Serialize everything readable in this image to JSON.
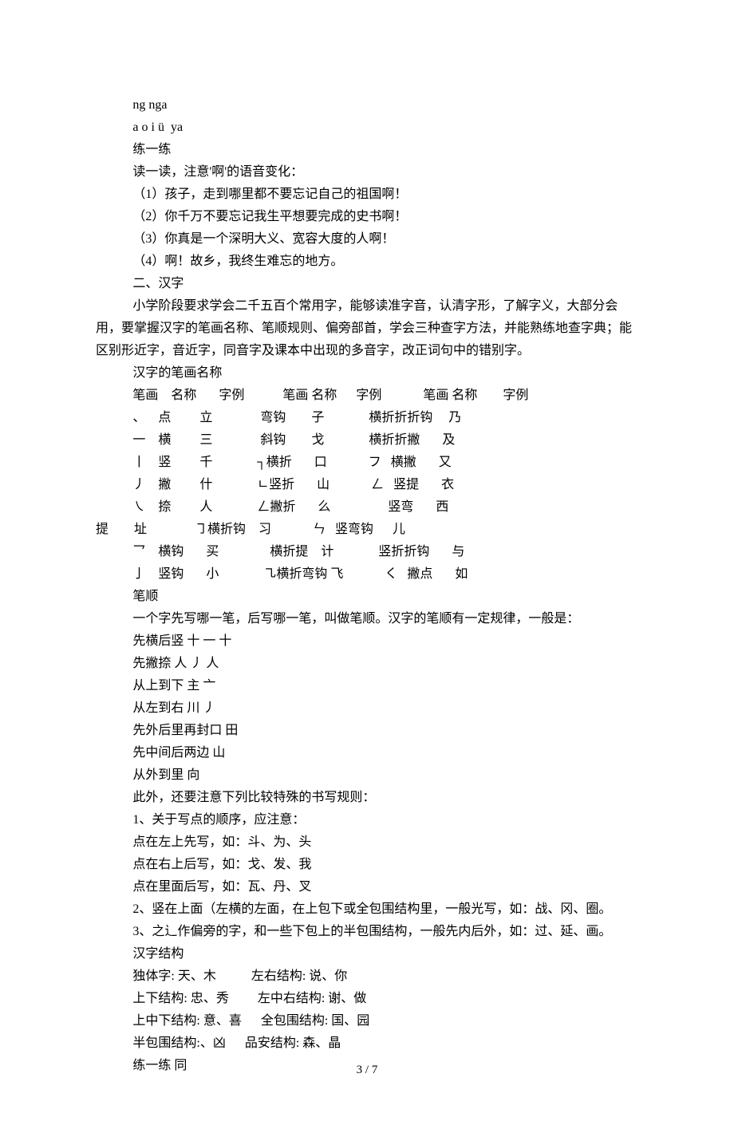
{
  "lines": {
    "l1": "ng nga",
    "l2": "a o i ü  ya",
    "l3": "练一练",
    "l4": "读一读，注意'啊'的语音变化：",
    "l5": "（1）孩子，走到哪里都不要忘记自己的祖国啊！",
    "l6": "（2）你千万不要忘记我生平想要完成的史书啊！",
    "l7": "（3）你真是一个深明大义、宽容大度的人啊！",
    "l8": "（4）啊！故乡，我终生难忘的地方。",
    "l9": "二、汉字",
    "l10": "小学阶段要求学会二千五百个常用字，能够读准字音，认清字形，了解字义，大部分会用，要掌握汉字的笔画名称、笔顺规则、偏旁部首，学会三种查字方法，并能熟练地查字典；能区别形近字，音近字，同音字及课本中出现的多音字，改正词句中的错别字。",
    "l11": "汉字的笔画名称",
    "th": "笔画    名称       字例            笔画 名称      字例             笔画 名称        字例",
    "r1": "、    点         立               弯钩        子              横折折折钩     乃",
    "r2": "一    横         三               斜钩        戈              横折折撇       及",
    "r3": "丨    竖         千              ┐横折       口             フ   横撇       又",
    "r4": "丿    撇         什              ㄴ竖折       山             ㄥ   竖提       衣",
    "r5": "㇏    捺         人              ㄥ撇折       么                  竖弯       西",
    "r6": "提        址               ㇆横折钩    习             ㄣ   竖弯钩      儿",
    "r7": "乛    横钩       买                横折提    计              竖折折钩       与",
    "r8": "亅    竖钩       小              ㇈横折弯钩 飞             く   撇点       如",
    "l12": "笔顺",
    "l13": "一个字先写哪一笔，后写哪一笔，叫做笔顺。汉字的笔顺有一定规律，一般是：",
    "l14": "先横后竖 十 一 十",
    "l15": "先撇捺 人 丿 人",
    "l16": "从上到下 主 亠",
    "l17": "从左到右 川 丿",
    "l18": "先外后里再封口 田",
    "l19": "先中间后两边 山",
    "l20": "从外到里 向",
    "l21": "此外，还要注意下列比较特殊的书写规则：",
    "l22": "1、关于写点的顺序，应注意：",
    "l23": "点在左上先写，如：斗、为、头",
    "l24": "点在右上后写，如：戈、发、我",
    "l25": "点在里面后写，如：瓦、丹、叉",
    "l26": "2、竖在上面（左横的左面，在上包下或全包围结构里，一般光写，如：战、冈、圈。",
    "l27": "3、之辶作偏旁的字，和一些下包上的半包围结构，一般先内后外，如：过、延、画。",
    "l28": "汉字结构",
    "l29": "独体字: 天、木           左右结构: 说、你",
    "l30": "上下结构: 忠、秀         左中右结构: 谢、做",
    "l31": "上中下结构: 意、喜      全包围结构: 国、园",
    "l32": "半包围结构:、凶      品安结构: 森、晶",
    "l33": "练一练 同"
  },
  "footer": "3 / 7"
}
